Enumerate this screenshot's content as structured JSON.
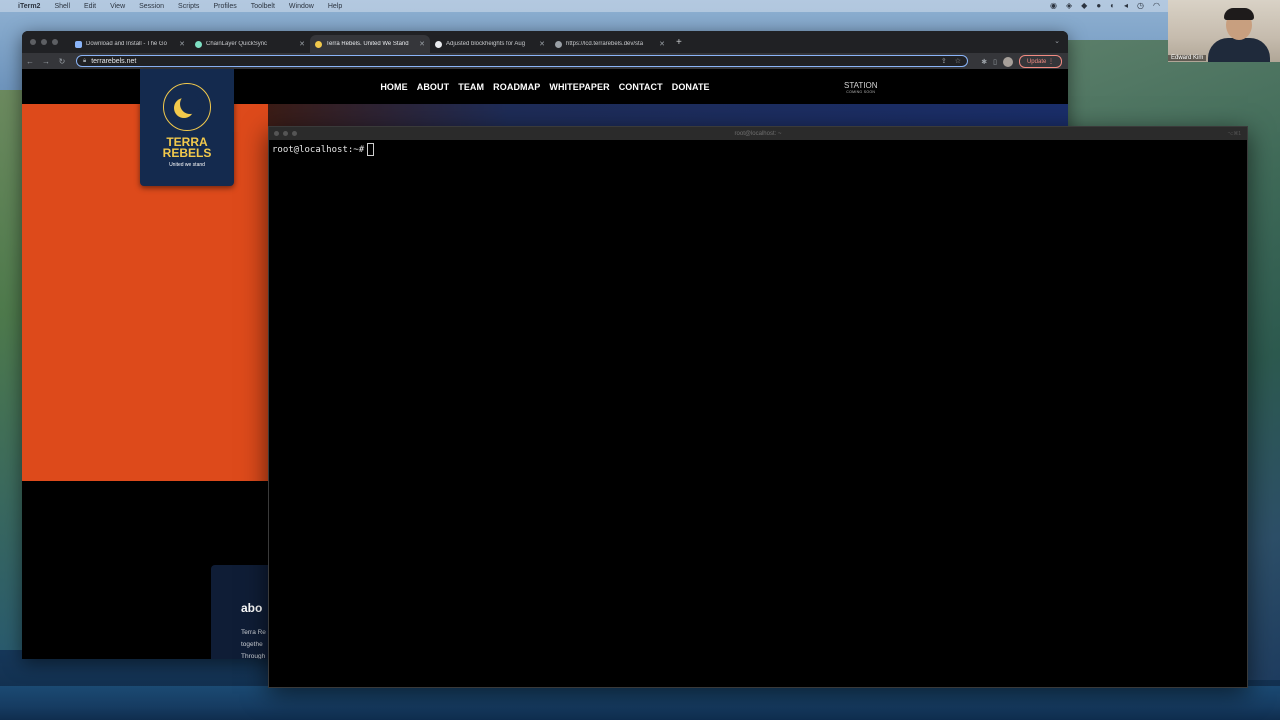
{
  "menubar": {
    "app": "iTerm2",
    "items": [
      "Shell",
      "Edit",
      "View",
      "Session",
      "Scripts",
      "Profiles",
      "Toolbelt",
      "Window",
      "Help"
    ]
  },
  "webcam": {
    "name": "Edward Kim"
  },
  "browser": {
    "tabs": [
      {
        "title": "Download and Install - The Go",
        "color": "#8ab4f8"
      },
      {
        "title": "ChainLayer QuickSync",
        "color": "#7ee0c3"
      },
      {
        "title": "Terra Rebels. United We Stand",
        "color": "#f2c94c"
      },
      {
        "title": "Adjusted blockheights for Aug",
        "color": "#e8eaed"
      },
      {
        "title": "https://lcd.terrarebels.dev/sta",
        "color": "#9aa0a6"
      }
    ],
    "url": "terrarebels.net",
    "update_label": "Update"
  },
  "site": {
    "nav": [
      "HOME",
      "ABOUT",
      "TEAM",
      "ROADMAP",
      "WHITEPAPER",
      "CONTACT",
      "DONATE"
    ],
    "station": "STATION",
    "station_sub": "COMING SOON",
    "logo_line1": "TERRA",
    "logo_line2": "REBELS",
    "logo_tagline": "United we stand",
    "about_title": "abo",
    "about_lines": [
      "Terra Re",
      "togethe",
      "Through"
    ]
  },
  "terminal": {
    "title": "root@localhost: ~",
    "shortcut": "⌥⌘1",
    "prompt": "root@localhost:~#"
  }
}
